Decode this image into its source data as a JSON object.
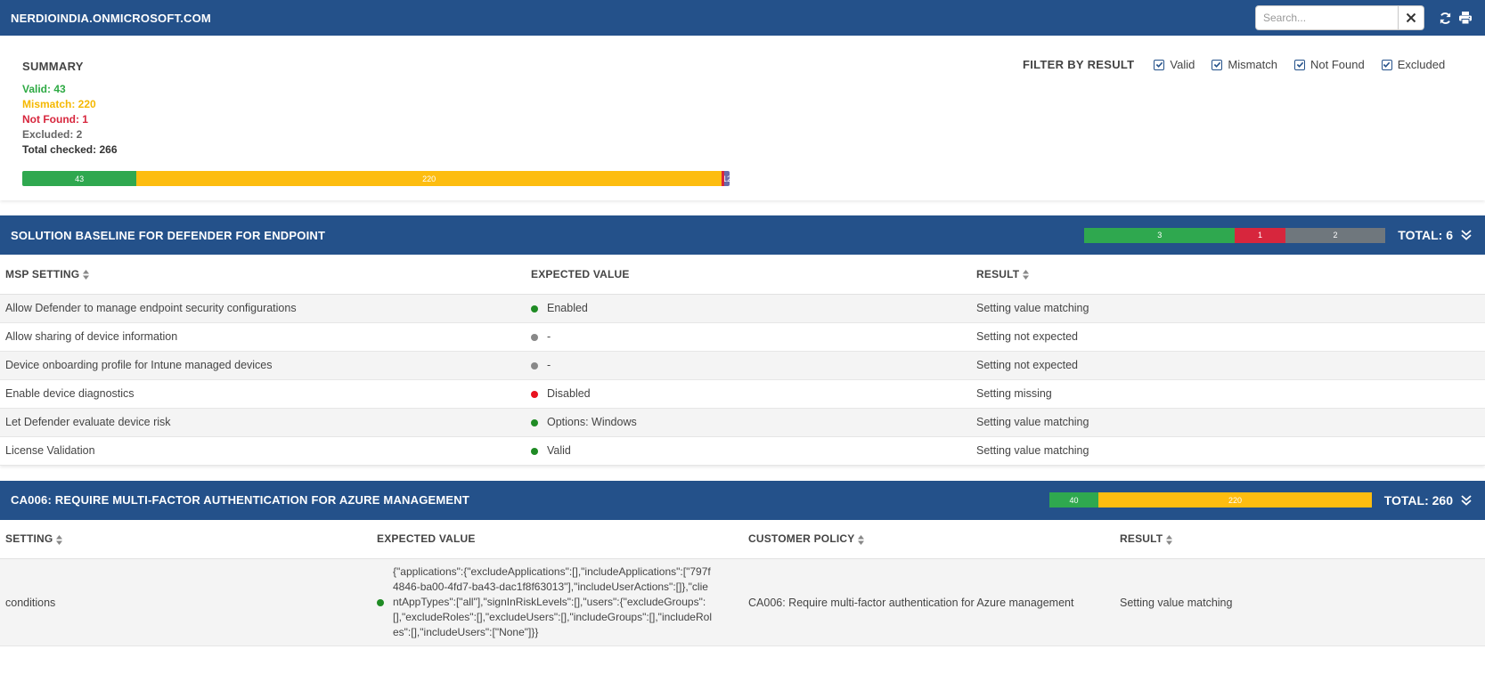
{
  "header": {
    "title": "NERDIOINDIA.ONMICROSOFT.COM",
    "search_placeholder": "Search..."
  },
  "summary": {
    "title": "SUMMARY",
    "valid": "Valid: 43",
    "mismatch": "Mismatch: 220",
    "not_found": "Not Found: 1",
    "excluded": "Excluded: 2",
    "total": "Total checked: 266",
    "bar": {
      "valid": 43,
      "mismatch": 220,
      "not_found": 1,
      "excluded": 2,
      "valid_label": "43",
      "mismatch_label": "220",
      "small_label": "12"
    }
  },
  "filter": {
    "label": "FILTER BY RESULT",
    "options": [
      {
        "label": "Valid",
        "checked": true
      },
      {
        "label": "Mismatch",
        "checked": true
      },
      {
        "label": "Not Found",
        "checked": true
      },
      {
        "label": "Excluded",
        "checked": true
      }
    ]
  },
  "section1": {
    "title": "SOLUTION BASELINE FOR DEFENDER FOR ENDPOINT",
    "bar": {
      "valid": 3,
      "not_found": 1,
      "excluded": 2
    },
    "bar_labels": {
      "valid": "3",
      "not_found": "1",
      "excluded": "2"
    },
    "total": "TOTAL: 6",
    "columns": [
      "MSP SETTING",
      "EXPECTED VALUE",
      "RESULT"
    ],
    "rows": [
      {
        "setting": "Allow Defender to manage endpoint security configurations",
        "status": "green",
        "expected": "Enabled",
        "result": "Setting value matching"
      },
      {
        "setting": "Allow sharing of device information",
        "status": "gray",
        "expected": "-",
        "result": "Setting not expected"
      },
      {
        "setting": "Device onboarding profile for Intune managed devices",
        "status": "gray",
        "expected": "-",
        "result": "Setting not expected"
      },
      {
        "setting": "Enable device diagnostics",
        "status": "red",
        "expected": "Disabled",
        "result": "Setting missing"
      },
      {
        "setting": "Let Defender evaluate device risk",
        "status": "green",
        "expected": "Options: Windows",
        "result": "Setting value matching"
      },
      {
        "setting": "License Validation",
        "status": "green",
        "expected": "Valid",
        "result": "Setting value matching"
      }
    ]
  },
  "section2": {
    "title": "CA006: REQUIRE MULTI-FACTOR AUTHENTICATION FOR AZURE MANAGEMENT",
    "bar": {
      "valid": 40,
      "mismatch": 220
    },
    "bar_labels": {
      "valid": "40",
      "mismatch": "220"
    },
    "total": "TOTAL: 260",
    "columns": [
      "SETTING",
      "EXPECTED VALUE",
      "CUSTOMER POLICY",
      "RESULT"
    ],
    "rows": [
      {
        "setting": "conditions",
        "status": "green",
        "expected": "{\"applications\":{\"excludeApplications\":[],\"includeApplications\":[\"797f4846-ba00-4fd7-ba43-dac1f8f63013\"],\"includeUserActions\":[]},\"clientAppTypes\":[\"all\"],\"signInRiskLevels\":[],\"users\":{\"excludeGroups\":[],\"excludeRoles\":[],\"excludeUsers\":[],\"includeGroups\":[],\"includeRoles\":[],\"includeUsers\":[\"None\"]}}",
        "policy": "CA006: Require multi-factor authentication for Azure management",
        "result": "Setting value matching"
      }
    ]
  }
}
